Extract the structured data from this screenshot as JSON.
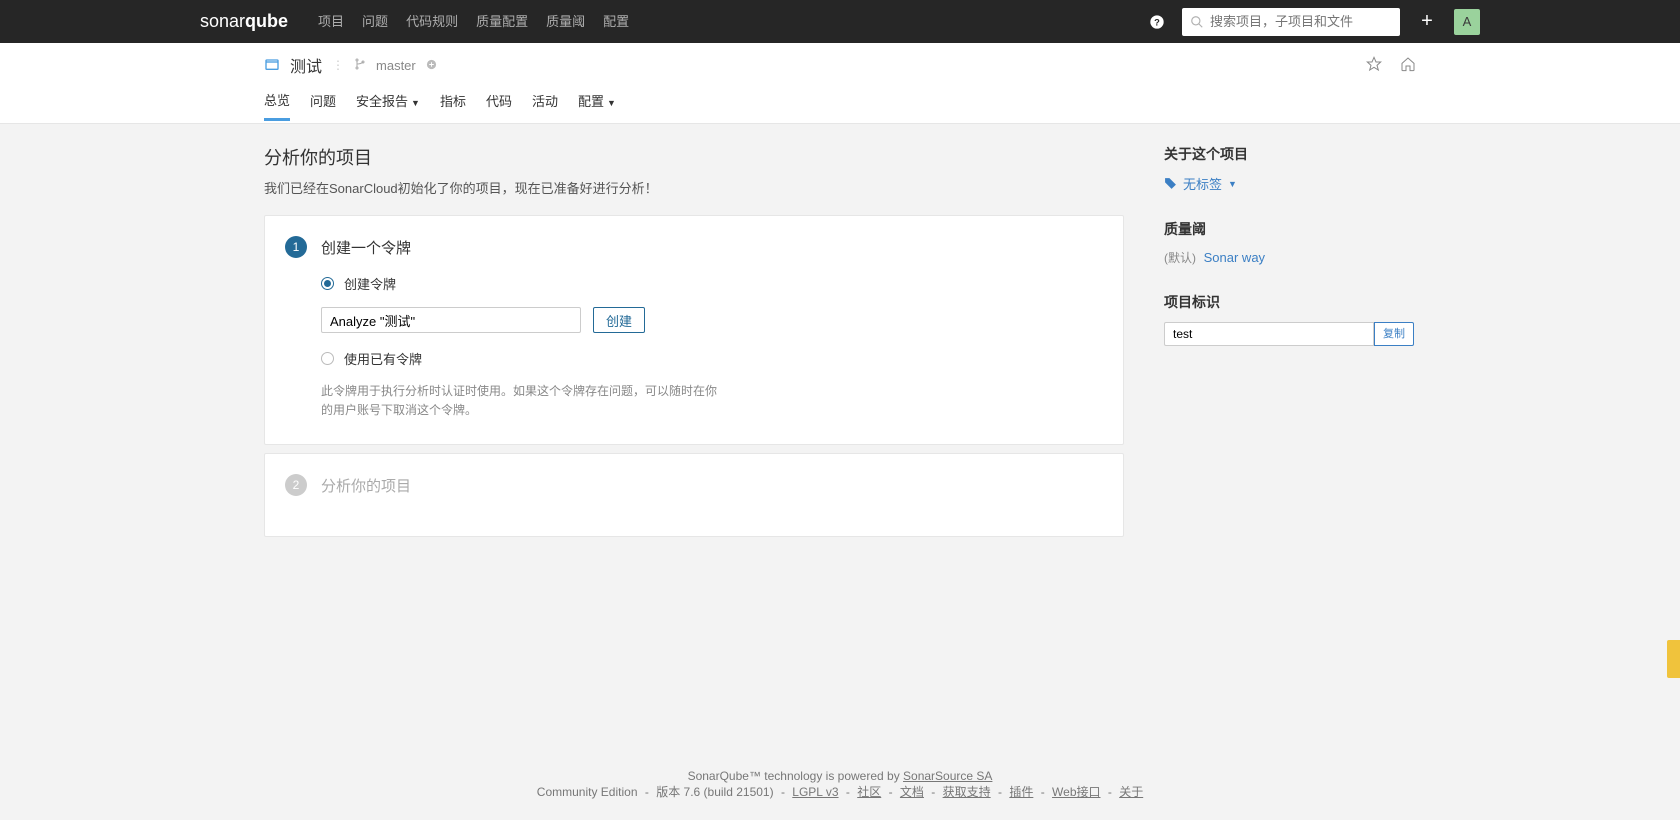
{
  "brand": {
    "part1": "sonar",
    "part2": "qube"
  },
  "topnav": {
    "items": [
      "项目",
      "问题",
      "代码规则",
      "质量配置",
      "质量阈",
      "配置"
    ]
  },
  "search": {
    "placeholder": "搜索项目，子项目和文件"
  },
  "avatar": {
    "initial": "A"
  },
  "project": {
    "name": "测试",
    "branch": "master"
  },
  "tabs": {
    "items": [
      "总览",
      "问题",
      "安全报告",
      "指标",
      "代码",
      "活动",
      "配置"
    ],
    "active": 0,
    "dropdown": [
      2,
      6
    ]
  },
  "page": {
    "title": "分析你的项目",
    "desc": "我们已经在SonarCloud初始化了你的项目，现在已准备好进行分析！"
  },
  "step1": {
    "num": "1",
    "title": "创建一个令牌",
    "radio_create": "创建令牌",
    "radio_existing": "使用已有令牌",
    "token_value": "Analyze \"测试\"",
    "create_btn": "创建",
    "help": "此令牌用于执行分析时认证时使用。如果这个令牌存在问题，可以随时在你的用户账号下取消这个令牌。"
  },
  "step2": {
    "num": "2",
    "title": "分析你的项目"
  },
  "sidebar": {
    "about_title": "关于这个项目",
    "no_tags": "无标签",
    "qg_title": "质量阈",
    "qg_default": "(默认)",
    "qg_name": "Sonar way",
    "key_title": "项目标识",
    "key_value": "test",
    "copy": "复制"
  },
  "footer": {
    "line1a": "SonarQube™ technology is powered by ",
    "line1b": "SonarSource SA",
    "edition": "Community Edition",
    "version": "版本 7.6 (build 21501)",
    "links": [
      "LGPL v3",
      "社区",
      "文档",
      "获取支持",
      "插件",
      "Web接口",
      "关于"
    ]
  }
}
